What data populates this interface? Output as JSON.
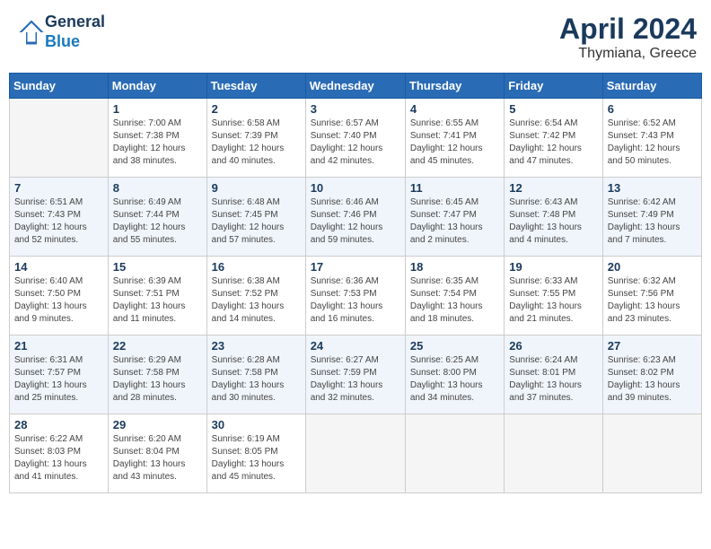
{
  "header": {
    "logo_line1": "General",
    "logo_line2": "Blue",
    "title": "April 2024",
    "subtitle": "Thymiana, Greece"
  },
  "calendar": {
    "weekdays": [
      "Sunday",
      "Monday",
      "Tuesday",
      "Wednesday",
      "Thursday",
      "Friday",
      "Saturday"
    ],
    "weeks": [
      [
        {
          "day": "",
          "info": ""
        },
        {
          "day": "1",
          "info": "Sunrise: 7:00 AM\nSunset: 7:38 PM\nDaylight: 12 hours\nand 38 minutes."
        },
        {
          "day": "2",
          "info": "Sunrise: 6:58 AM\nSunset: 7:39 PM\nDaylight: 12 hours\nand 40 minutes."
        },
        {
          "day": "3",
          "info": "Sunrise: 6:57 AM\nSunset: 7:40 PM\nDaylight: 12 hours\nand 42 minutes."
        },
        {
          "day": "4",
          "info": "Sunrise: 6:55 AM\nSunset: 7:41 PM\nDaylight: 12 hours\nand 45 minutes."
        },
        {
          "day": "5",
          "info": "Sunrise: 6:54 AM\nSunset: 7:42 PM\nDaylight: 12 hours\nand 47 minutes."
        },
        {
          "day": "6",
          "info": "Sunrise: 6:52 AM\nSunset: 7:43 PM\nDaylight: 12 hours\nand 50 minutes."
        }
      ],
      [
        {
          "day": "7",
          "info": "Sunrise: 6:51 AM\nSunset: 7:43 PM\nDaylight: 12 hours\nand 52 minutes."
        },
        {
          "day": "8",
          "info": "Sunrise: 6:49 AM\nSunset: 7:44 PM\nDaylight: 12 hours\nand 55 minutes."
        },
        {
          "day": "9",
          "info": "Sunrise: 6:48 AM\nSunset: 7:45 PM\nDaylight: 12 hours\nand 57 minutes."
        },
        {
          "day": "10",
          "info": "Sunrise: 6:46 AM\nSunset: 7:46 PM\nDaylight: 12 hours\nand 59 minutes."
        },
        {
          "day": "11",
          "info": "Sunrise: 6:45 AM\nSunset: 7:47 PM\nDaylight: 13 hours\nand 2 minutes."
        },
        {
          "day": "12",
          "info": "Sunrise: 6:43 AM\nSunset: 7:48 PM\nDaylight: 13 hours\nand 4 minutes."
        },
        {
          "day": "13",
          "info": "Sunrise: 6:42 AM\nSunset: 7:49 PM\nDaylight: 13 hours\nand 7 minutes."
        }
      ],
      [
        {
          "day": "14",
          "info": "Sunrise: 6:40 AM\nSunset: 7:50 PM\nDaylight: 13 hours\nand 9 minutes."
        },
        {
          "day": "15",
          "info": "Sunrise: 6:39 AM\nSunset: 7:51 PM\nDaylight: 13 hours\nand 11 minutes."
        },
        {
          "day": "16",
          "info": "Sunrise: 6:38 AM\nSunset: 7:52 PM\nDaylight: 13 hours\nand 14 minutes."
        },
        {
          "day": "17",
          "info": "Sunrise: 6:36 AM\nSunset: 7:53 PM\nDaylight: 13 hours\nand 16 minutes."
        },
        {
          "day": "18",
          "info": "Sunrise: 6:35 AM\nSunset: 7:54 PM\nDaylight: 13 hours\nand 18 minutes."
        },
        {
          "day": "19",
          "info": "Sunrise: 6:33 AM\nSunset: 7:55 PM\nDaylight: 13 hours\nand 21 minutes."
        },
        {
          "day": "20",
          "info": "Sunrise: 6:32 AM\nSunset: 7:56 PM\nDaylight: 13 hours\nand 23 minutes."
        }
      ],
      [
        {
          "day": "21",
          "info": "Sunrise: 6:31 AM\nSunset: 7:57 PM\nDaylight: 13 hours\nand 25 minutes."
        },
        {
          "day": "22",
          "info": "Sunrise: 6:29 AM\nSunset: 7:58 PM\nDaylight: 13 hours\nand 28 minutes."
        },
        {
          "day": "23",
          "info": "Sunrise: 6:28 AM\nSunset: 7:58 PM\nDaylight: 13 hours\nand 30 minutes."
        },
        {
          "day": "24",
          "info": "Sunrise: 6:27 AM\nSunset: 7:59 PM\nDaylight: 13 hours\nand 32 minutes."
        },
        {
          "day": "25",
          "info": "Sunrise: 6:25 AM\nSunset: 8:00 PM\nDaylight: 13 hours\nand 34 minutes."
        },
        {
          "day": "26",
          "info": "Sunrise: 6:24 AM\nSunset: 8:01 PM\nDaylight: 13 hours\nand 37 minutes."
        },
        {
          "day": "27",
          "info": "Sunrise: 6:23 AM\nSunset: 8:02 PM\nDaylight: 13 hours\nand 39 minutes."
        }
      ],
      [
        {
          "day": "28",
          "info": "Sunrise: 6:22 AM\nSunset: 8:03 PM\nDaylight: 13 hours\nand 41 minutes."
        },
        {
          "day": "29",
          "info": "Sunrise: 6:20 AM\nSunset: 8:04 PM\nDaylight: 13 hours\nand 43 minutes."
        },
        {
          "day": "30",
          "info": "Sunrise: 6:19 AM\nSunset: 8:05 PM\nDaylight: 13 hours\nand 45 minutes."
        },
        {
          "day": "",
          "info": ""
        },
        {
          "day": "",
          "info": ""
        },
        {
          "day": "",
          "info": ""
        },
        {
          "day": "",
          "info": ""
        }
      ]
    ]
  }
}
